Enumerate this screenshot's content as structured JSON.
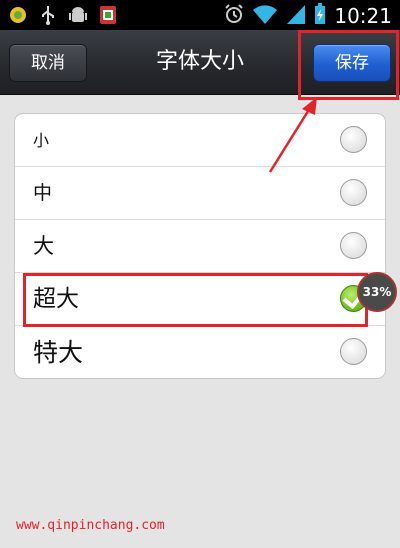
{
  "status_bar": {
    "time": "10:21",
    "left_icons": [
      "sync-icon",
      "usb-icon",
      "android-icon",
      "app-icon"
    ],
    "right_icons": [
      "alarm-icon",
      "wifi-icon",
      "signal-icon",
      "battery-icon"
    ]
  },
  "header": {
    "cancel_label": "取消",
    "title": "字体大小",
    "save_label": "保存"
  },
  "font_sizes": {
    "options": [
      {
        "label": "小",
        "selected": false
      },
      {
        "label": "中",
        "selected": false
      },
      {
        "label": "大",
        "selected": false
      },
      {
        "label": "超大",
        "selected": true
      },
      {
        "label": "特大",
        "selected": false
      }
    ]
  },
  "overlay": {
    "badge_text": "33%",
    "watermark": "www.qinpinchang.com"
  },
  "colors": {
    "accent_blue": "#1f5fd2",
    "annotation_red": "#e3232a",
    "check_green": "#6fbe1f"
  }
}
